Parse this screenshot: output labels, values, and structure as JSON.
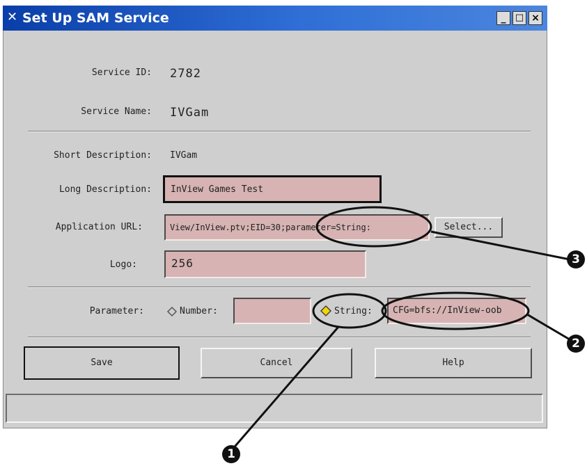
{
  "window": {
    "title": "Set Up SAM Service",
    "icon": "x-window-icon",
    "controls": {
      "minimize": "_",
      "maximize": "□",
      "close": "×"
    }
  },
  "form": {
    "service_id": {
      "label": "Service ID:",
      "value": "2782"
    },
    "service_name": {
      "label": "Service Name:",
      "value": "IVGam"
    },
    "short_description": {
      "label": "Short Description:",
      "value": "IVGam"
    },
    "long_description": {
      "label": "Long Description:",
      "value": "InView Games Test"
    },
    "application_url": {
      "label": "Application URL:",
      "value": "View/InView.ptv;EID=30;parameter=String:",
      "select_label": "Select..."
    },
    "logo": {
      "label": "Logo:",
      "value": "256"
    },
    "parameter": {
      "label": "Parameter:",
      "number_label": "Number:",
      "number_value": "",
      "string_label": "String:",
      "string_value": "CFG=bfs://InView-oob",
      "selected": "String"
    }
  },
  "buttons": {
    "save": "Save",
    "cancel": "Cancel",
    "help": "Help"
  },
  "status_text": "",
  "callouts": [
    "1",
    "2",
    "3"
  ],
  "colors": {
    "field_bg": "#d7b3b3",
    "titlebar": "#1f55c2",
    "window_bg": "#cfcfcf",
    "radio_selected": "#f2d700"
  }
}
